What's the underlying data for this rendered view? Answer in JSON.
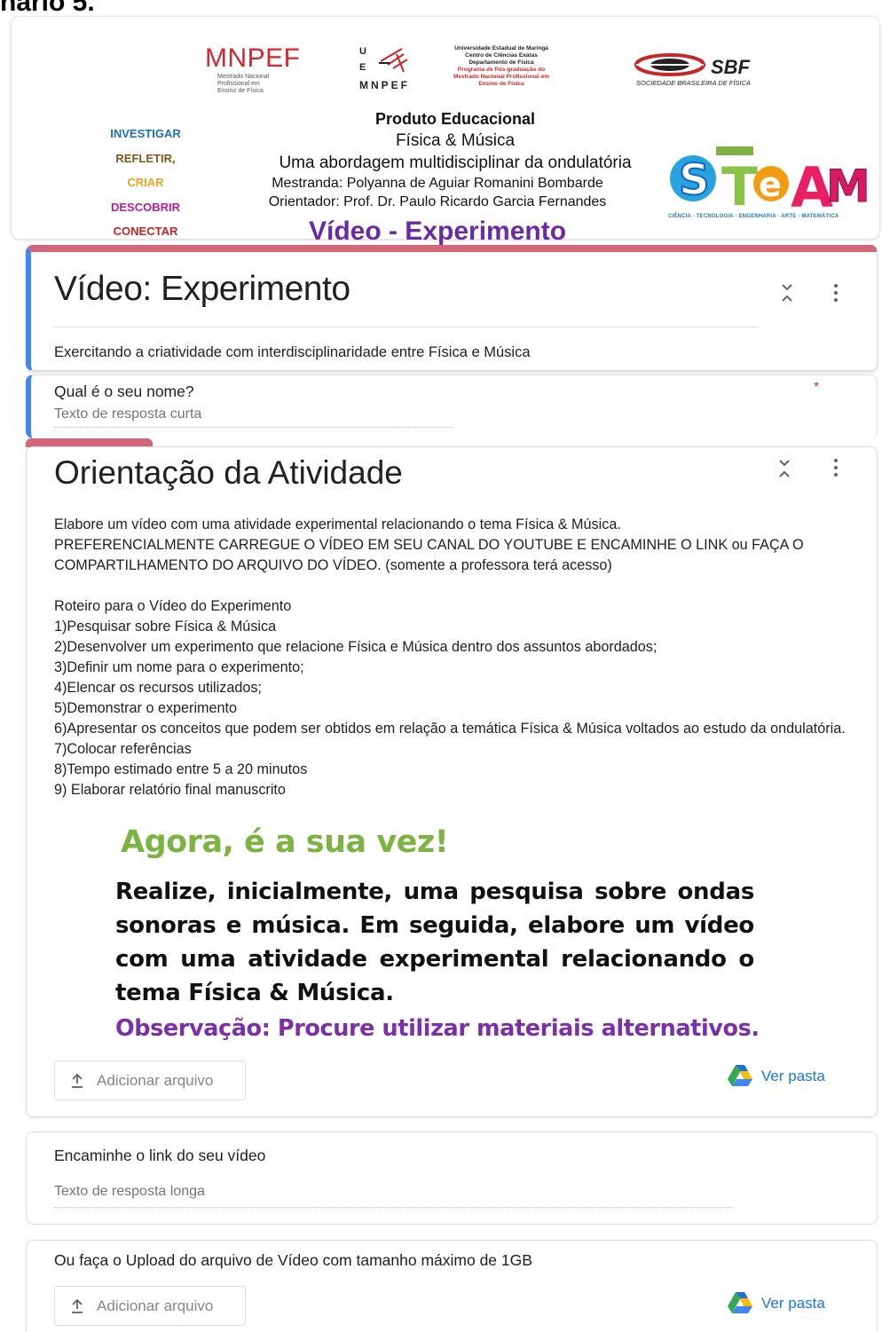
{
  "top_label": "nário 5.",
  "banner": {
    "mnpef_logo": "MNPEF",
    "mnpef_logo_sub": [
      "Mestrado Nacional",
      "Profissional em",
      "Ensino de Física"
    ],
    "uem_letters": [
      "U",
      "E"
    ],
    "uem_mnpef": "MNPEF",
    "uem_text": [
      "Universidade Estadual de Maringá",
      "Centro de Ciências Exatas",
      "Departamento de Física"
    ],
    "uem_text_red": [
      "Programa de Pós-graduação do",
      "Mestrado Nacional Profissional em",
      "Ensino de Física"
    ],
    "sbf_logo": "SBF",
    "sbf_sub": "SOCIEDADE BRASILEIRA DE FÍSICA",
    "steps": [
      "INVESTIGAR",
      "REFLETIR,",
      "CRIAR",
      "DESCOBRIR",
      "CONECTAR"
    ],
    "product_title": "Produto Educacional",
    "product_subtitle": "Física & Música",
    "product_line": "Uma abordagem multidisciplinar da ondulatória",
    "student": "Mestranda: Polyanna de Aguiar Romanini Bombarde",
    "advisor": "Orientador: Prof. Dr. Paulo Ricardo Garcia Fernandes",
    "video_title": "Vídeo - Experimento",
    "steam_logo": "STEAM",
    "steam_caption": "CIÊNCIA - TECNOLOGIA - ENGENHARIA - ARTE - MATEMÁTICA"
  },
  "form": {
    "title": "Vídeo: Experimento",
    "description": "Exercitando a criatividade com interdisciplinaridade entre Física e Música"
  },
  "question1": {
    "label": "Qual é o seu nome?",
    "required_mark": "*",
    "placeholder": "Texto de resposta curta"
  },
  "section": {
    "title": "Orientação da Atividade",
    "intro_lines": [
      "Elabore um vídeo com uma atividade experimental relacionando o tema Física & Música.",
      "PREFERENCIALMENTE CARREGUE O VÍDEO EM SEU CANAL DO YOUTUBE E ENCAMINHE O LINK ou FAÇA O",
      "COMPARTILHAMENTO DO ARQUIVO DO VÍDEO. (somente a professora terá acesso)"
    ],
    "script_title": "Roteiro para o Vídeo do Experimento",
    "steps": [
      "1)Pesquisar sobre Física & Música",
      "2)Desenvolver um experimento que relacione Física e Música dentro dos assuntos abordados;",
      "3)Definir um nome para o experimento;",
      "4)Elencar os recursos utilizados;",
      "5)Demonstrar o experimento",
      "6)Apresentar os conceitos que podem ser obtidos em relação a temática Física & Música voltados ao estudo da ondulatória.",
      "7)Colocar referências",
      "8)Tempo estimado entre 5 a 20 minutos",
      "9) Elaborar relatório final manuscrito"
    ],
    "callout_heading": "Agora, é a sua vez!",
    "callout_text": "Realize, inicialmente, uma pesquisa sobre ondas sonoras e música. Em seguida, elabore um vídeo com uma atividade experimental relacionando o tema Física & Música.",
    "callout_note": "Observação: Procure utilizar materiais alternativos.",
    "add_file_label": "Adicionar arquivo",
    "view_folder_label": "Ver pasta"
  },
  "question2": {
    "label": "Encaminhe o link  do seu vídeo",
    "placeholder": "Texto de resposta longa"
  },
  "question3": {
    "label": "Ou  faça o Upload  do arquivo  de Vídeo com tamanho máximo de 1GB",
    "add_file_label": "Adicionar arquivo",
    "view_folder_label": "Ver pasta"
  },
  "colors": {
    "accent_blue": "#4285f4",
    "header_pink": "#d4667a",
    "link_blue": "#1a73e8",
    "callout_green": "#7cb342",
    "callout_purple": "#7b2fa8",
    "banner_purple": "#6a2aa3"
  },
  "icons": [
    "collapse-icon",
    "more-vert-icon",
    "upload-icon",
    "google-drive-icon"
  ]
}
